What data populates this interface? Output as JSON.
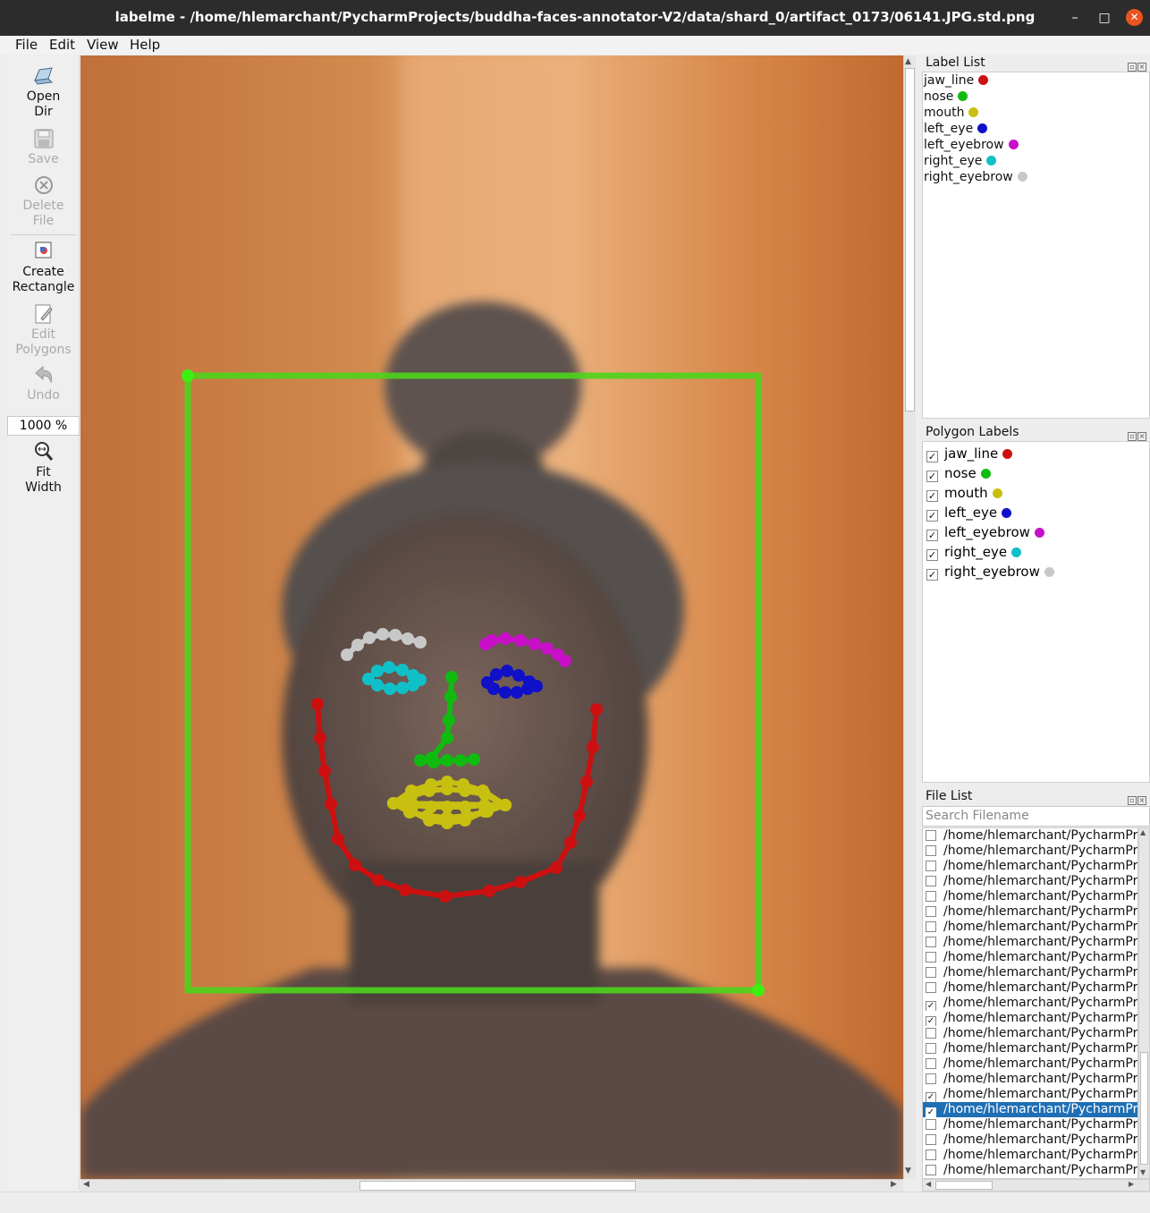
{
  "window": {
    "title": "labelme - /home/hlemarchant/PycharmProjects/buddha-faces-annotator-V2/data/shard_0/artifact_0173/06141.JPG.std.png",
    "minimize": "–",
    "maximize": "□",
    "close": "✕"
  },
  "menu": [
    "File",
    "Edit",
    "View",
    "Help"
  ],
  "toolbar": {
    "open_dir": [
      "Open",
      "Dir"
    ],
    "save": "Save",
    "delete_file": [
      "Delete",
      "File"
    ],
    "create_rectangle": [
      "Create",
      "Rectangle"
    ],
    "edit_polygons": [
      "Edit",
      "Polygons"
    ],
    "undo": "Undo",
    "zoom": "1000 %",
    "fit_width": [
      "Fit",
      "Width"
    ]
  },
  "label_list": {
    "title": "Label List",
    "items": [
      {
        "label": "jaw_line",
        "color": "#cc1010"
      },
      {
        "label": "nose",
        "color": "#10bb10"
      },
      {
        "label": "mouth",
        "color": "#c8c010"
      },
      {
        "label": "left_eye",
        "color": "#1010c8"
      },
      {
        "label": "left_eyebrow",
        "color": "#c810c8"
      },
      {
        "label": "right_eye",
        "color": "#10c0c8"
      },
      {
        "label": "right_eyebrow",
        "color": "#c8c8c8"
      }
    ]
  },
  "polygon_labels": {
    "title": "Polygon Labels",
    "items": [
      {
        "label": "jaw_line",
        "color": "#cc1010",
        "checked": true
      },
      {
        "label": "nose",
        "color": "#10bb10",
        "checked": true
      },
      {
        "label": "mouth",
        "color": "#c8c010",
        "checked": true
      },
      {
        "label": "left_eye",
        "color": "#1010c8",
        "checked": true
      },
      {
        "label": "left_eyebrow",
        "color": "#c810c8",
        "checked": true
      },
      {
        "label": "right_eye",
        "color": "#10c0c8",
        "checked": true
      },
      {
        "label": "right_eyebrow",
        "color": "#c8c8c8",
        "checked": true
      }
    ]
  },
  "file_list": {
    "title": "File List",
    "search_placeholder": "Search Filename",
    "items": [
      {
        "path": "/home/hlemarchant/PycharmProjects",
        "checked": false
      },
      {
        "path": "/home/hlemarchant/PycharmProjects",
        "checked": false
      },
      {
        "path": "/home/hlemarchant/PycharmProjects",
        "checked": false
      },
      {
        "path": "/home/hlemarchant/PycharmProjects",
        "checked": false
      },
      {
        "path": "/home/hlemarchant/PycharmProjects",
        "checked": false
      },
      {
        "path": "/home/hlemarchant/PycharmProjects",
        "checked": false
      },
      {
        "path": "/home/hlemarchant/PycharmProjects",
        "checked": false
      },
      {
        "path": "/home/hlemarchant/PycharmProjects",
        "checked": false
      },
      {
        "path": "/home/hlemarchant/PycharmProjects",
        "checked": false
      },
      {
        "path": "/home/hlemarchant/PycharmProjects",
        "checked": false
      },
      {
        "path": "/home/hlemarchant/PycharmProjects",
        "checked": false
      },
      {
        "path": "/home/hlemarchant/PycharmProjects",
        "checked": true
      },
      {
        "path": "/home/hlemarchant/PycharmProjects",
        "checked": true
      },
      {
        "path": "/home/hlemarchant/PycharmProjects",
        "checked": false
      },
      {
        "path": "/home/hlemarchant/PycharmProjects",
        "checked": false
      },
      {
        "path": "/home/hlemarchant/PycharmProjects",
        "checked": false
      },
      {
        "path": "/home/hlemarchant/PycharmProjects",
        "checked": false
      },
      {
        "path": "/home/hlemarchant/PycharmProjects",
        "checked": true
      },
      {
        "path": "/home/hlemarchant/PycharmProjects",
        "checked": true,
        "selected": true
      },
      {
        "path": "/home/hlemarchant/PycharmProjects",
        "checked": false
      },
      {
        "path": "/home/hlemarchant/PycharmProjects",
        "checked": false
      },
      {
        "path": "/home/hlemarchant/PycharmProjects",
        "checked": false
      },
      {
        "path": "/home/hlemarchant/PycharmProjects",
        "checked": false
      }
    ]
  },
  "colors": {
    "bbox": "#4cd41c",
    "jaw_line": "#cc1010",
    "nose": "#10bb10",
    "mouth": "#c8c010",
    "left_eye": "#1010c8",
    "left_eyebrow": "#c810c8",
    "right_eye": "#10c0c8",
    "right_eyebrow": "#c8c8c8"
  }
}
